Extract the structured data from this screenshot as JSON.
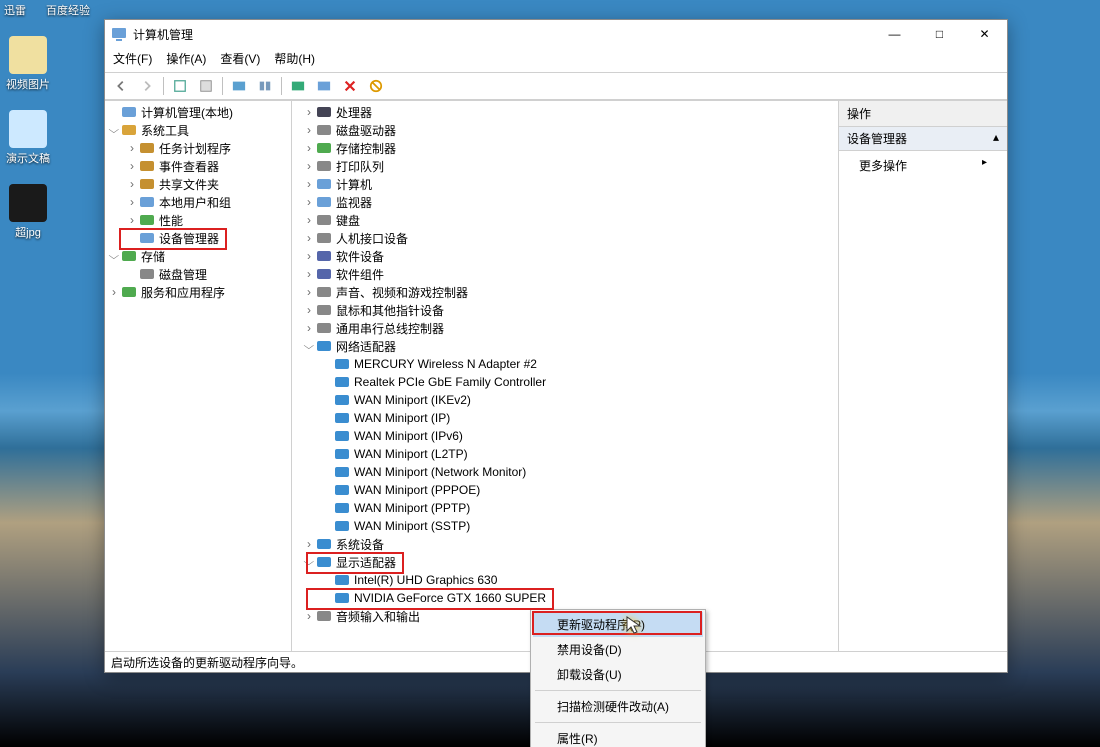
{
  "desktop": {
    "topLabels": [
      "迅雷",
      "百度经验"
    ],
    "icons": [
      {
        "label": "视频图片",
        "cls": ""
      },
      {
        "label": "演示文稿",
        "cls": "blue"
      },
      {
        "label": "超jpg",
        "cls": "dark"
      }
    ]
  },
  "window": {
    "title": "计算机管理",
    "menus": [
      "文件(F)",
      "操作(A)",
      "查看(V)",
      "帮助(H)"
    ]
  },
  "leftTree": [
    {
      "depth": 0,
      "arrow": "none",
      "icon": "mgmt",
      "label": "计算机管理(本地)"
    },
    {
      "depth": 0,
      "arrow": "exp",
      "icon": "tools",
      "label": "系统工具"
    },
    {
      "depth": 1,
      "arrow": "col",
      "icon": "sched",
      "label": "任务计划程序"
    },
    {
      "depth": 1,
      "arrow": "col",
      "icon": "event",
      "label": "事件查看器"
    },
    {
      "depth": 1,
      "arrow": "col",
      "icon": "share",
      "label": "共享文件夹"
    },
    {
      "depth": 1,
      "arrow": "col",
      "icon": "users",
      "label": "本地用户和组"
    },
    {
      "depth": 1,
      "arrow": "col",
      "icon": "perf",
      "label": "性能"
    },
    {
      "depth": 1,
      "arrow": "none",
      "icon": "devmgr",
      "label": "设备管理器",
      "redBox": true
    },
    {
      "depth": 0,
      "arrow": "exp",
      "icon": "storage",
      "label": "存储"
    },
    {
      "depth": 1,
      "arrow": "none",
      "icon": "disk",
      "label": "磁盘管理"
    },
    {
      "depth": 0,
      "arrow": "col",
      "icon": "services",
      "label": "服务和应用程序"
    }
  ],
  "midTree": [
    {
      "depth": 0,
      "arrow": "col",
      "icon": "cpu",
      "label": "处理器"
    },
    {
      "depth": 0,
      "arrow": "col",
      "icon": "diskd",
      "label": "磁盘驱动器"
    },
    {
      "depth": 0,
      "arrow": "col",
      "icon": "stor",
      "label": "存储控制器"
    },
    {
      "depth": 0,
      "arrow": "col",
      "icon": "print",
      "label": "打印队列"
    },
    {
      "depth": 0,
      "arrow": "col",
      "icon": "pc",
      "label": "计算机"
    },
    {
      "depth": 0,
      "arrow": "col",
      "icon": "mon",
      "label": "监视器"
    },
    {
      "depth": 0,
      "arrow": "col",
      "icon": "kbd",
      "label": "键盘"
    },
    {
      "depth": 0,
      "arrow": "col",
      "icon": "hid",
      "label": "人机接口设备"
    },
    {
      "depth": 0,
      "arrow": "col",
      "icon": "sw",
      "label": "软件设备"
    },
    {
      "depth": 0,
      "arrow": "col",
      "icon": "swc",
      "label": "软件组件"
    },
    {
      "depth": 0,
      "arrow": "col",
      "icon": "audio",
      "label": "声音、视频和游戏控制器"
    },
    {
      "depth": 0,
      "arrow": "col",
      "icon": "mouse",
      "label": "鼠标和其他指针设备"
    },
    {
      "depth": 0,
      "arrow": "col",
      "icon": "usb",
      "label": "通用串行总线控制器"
    },
    {
      "depth": 0,
      "arrow": "exp",
      "icon": "net",
      "label": "网络适配器"
    },
    {
      "depth": 1,
      "arrow": "none",
      "icon": "net",
      "label": "MERCURY Wireless N Adapter #2"
    },
    {
      "depth": 1,
      "arrow": "none",
      "icon": "net",
      "label": "Realtek PCIe GbE Family Controller"
    },
    {
      "depth": 1,
      "arrow": "none",
      "icon": "net",
      "label": "WAN Miniport (IKEv2)"
    },
    {
      "depth": 1,
      "arrow": "none",
      "icon": "net",
      "label": "WAN Miniport (IP)"
    },
    {
      "depth": 1,
      "arrow": "none",
      "icon": "net",
      "label": "WAN Miniport (IPv6)"
    },
    {
      "depth": 1,
      "arrow": "none",
      "icon": "net",
      "label": "WAN Miniport (L2TP)"
    },
    {
      "depth": 1,
      "arrow": "none",
      "icon": "net",
      "label": "WAN Miniport (Network Monitor)"
    },
    {
      "depth": 1,
      "arrow": "none",
      "icon": "net",
      "label": "WAN Miniport (PPPOE)"
    },
    {
      "depth": 1,
      "arrow": "none",
      "icon": "net",
      "label": "WAN Miniport (PPTP)"
    },
    {
      "depth": 1,
      "arrow": "none",
      "icon": "net",
      "label": "WAN Miniport (SSTP)"
    },
    {
      "depth": 0,
      "arrow": "col",
      "icon": "sys",
      "label": "系统设备"
    },
    {
      "depth": 0,
      "arrow": "exp",
      "icon": "disp",
      "label": "显示适配器",
      "redBox": true
    },
    {
      "depth": 1,
      "arrow": "none",
      "icon": "disp",
      "label": "Intel(R) UHD Graphics 630"
    },
    {
      "depth": 1,
      "arrow": "none",
      "icon": "disp",
      "label": "NVIDIA GeForce GTX 1660 SUPER",
      "redBox": true
    },
    {
      "depth": 0,
      "arrow": "col",
      "icon": "aio",
      "label": "音频输入和输出"
    }
  ],
  "rightPanel": {
    "header": "操作",
    "section": "设备管理器",
    "link": "更多操作"
  },
  "contextMenu": {
    "items": [
      {
        "label": "更新驱动程序(P)",
        "sel": true
      },
      {
        "label": "禁用设备(D)"
      },
      {
        "label": "卸载设备(U)"
      },
      {
        "sep": true
      },
      {
        "label": "扫描检测硬件改动(A)"
      },
      {
        "sep": true
      },
      {
        "label": "属性(R)"
      }
    ]
  },
  "statusbar": "启动所选设备的更新驱动程序向导。",
  "iconColors": {
    "mgmt": "#6aa0d8",
    "tools": "#d9a43a",
    "sched": "#c59030",
    "event": "#c59030",
    "share": "#c59030",
    "users": "#6aa0d8",
    "perf": "#4faa4f",
    "devmgr": "#6aa0d8",
    "storage": "#4faa4f",
    "disk": "#888",
    "services": "#4faa4f",
    "cpu": "#445",
    "diskd": "#888",
    "stor": "#4faa4f",
    "print": "#888",
    "pc": "#6aa0d8",
    "mon": "#6aa0d8",
    "kbd": "#888",
    "hid": "#888",
    "sw": "#56a",
    "swc": "#56a",
    "audio": "#888",
    "mouse": "#888",
    "usb": "#888",
    "net": "#3a8dd0",
    "sys": "#3a8dd0",
    "disp": "#3a8dd0",
    "aio": "#888"
  }
}
